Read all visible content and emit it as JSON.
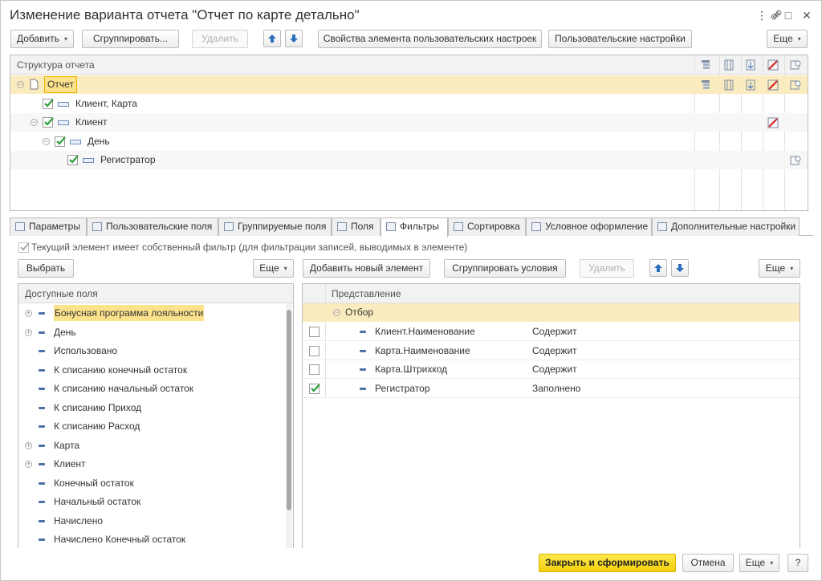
{
  "window": {
    "title": "Изменение варианта отчета \"Отчет по карте детально\"",
    "controls": [
      "⋮",
      "🔗",
      "□",
      "✕"
    ]
  },
  "toolbar": {
    "add_label": "Добавить",
    "group_label": "Сгруппировать...",
    "delete_label": "Удалить",
    "element_settings_label": "Свойства элемента пользовательских настроек",
    "user_settings_label": "Пользовательские настройки",
    "more_label": "Еще"
  },
  "structure": {
    "header": "Структура отчета",
    "rows": [
      {
        "label": "Отчет",
        "level": 0,
        "selected": true
      },
      {
        "label": "Клиент, Карта",
        "level": 1,
        "checked": true
      },
      {
        "label": "Клиент",
        "level": 1,
        "checked": true
      },
      {
        "label": "День",
        "level": 2,
        "checked": true
      },
      {
        "label": "Регистратор",
        "level": 3,
        "checked": true
      }
    ]
  },
  "tabs": [
    {
      "label": "Параметры"
    },
    {
      "label": "Пользовательские поля"
    },
    {
      "label": "Группируемые поля"
    },
    {
      "label": "Поля"
    },
    {
      "label": "Фильтры",
      "active": true
    },
    {
      "label": "Сортировка"
    },
    {
      "label": "Условное оформление"
    },
    {
      "label": "Дополнительные настройки"
    }
  ],
  "filters": {
    "own_filter_label": "Текущий элемент имеет собственный фильтр (для фильтрации записей, выводимых в элементе)",
    "select_label": "Выбрать",
    "more_left_label": "Еще",
    "add_new_label": "Добавить новый элемент",
    "group_conditions_label": "Сгруппировать условия",
    "delete_label": "Удалить",
    "more_right_label": "Еще",
    "available_header": "Доступные поля",
    "available_fields": [
      {
        "label": "Бонусная программа лояльности",
        "expandable": true,
        "selected": true
      },
      {
        "label": "День",
        "expandable": true
      },
      {
        "label": "Использовано"
      },
      {
        "label": "К списанию конечный остаток"
      },
      {
        "label": "К списанию начальный остаток"
      },
      {
        "label": "К списанию Приход"
      },
      {
        "label": "К списанию Расход"
      },
      {
        "label": "Карта",
        "expandable": true
      },
      {
        "label": "Клиент",
        "expandable": true
      },
      {
        "label": "Конечный остаток"
      },
      {
        "label": "Начальный остаток"
      },
      {
        "label": "Начислено"
      },
      {
        "label": "Начислено Конечный остаток"
      }
    ],
    "conditions_header": "Представление",
    "group_row": "Отбор",
    "conditions": [
      {
        "field": "Клиент.Наименование",
        "comparison": "Содержит",
        "checked": false
      },
      {
        "field": "Карта.Наименование",
        "comparison": "Содержит",
        "checked": false
      },
      {
        "field": "Карта.Штрихкод",
        "comparison": "Содержит",
        "checked": false
      },
      {
        "field": "Регистратор",
        "comparison": "Заполнено",
        "checked": true
      }
    ]
  },
  "footer": {
    "close_and_generate_label": "Закрыть и сформировать",
    "cancel_label": "Отмена",
    "more_label": "Еще",
    "help_label": "?"
  },
  "colors": {
    "accent_yellow": "#f4cf0a",
    "selection": "#fbecc0",
    "check_green": "#2e9e3a",
    "arrow_blue": "#2a6ebb"
  }
}
